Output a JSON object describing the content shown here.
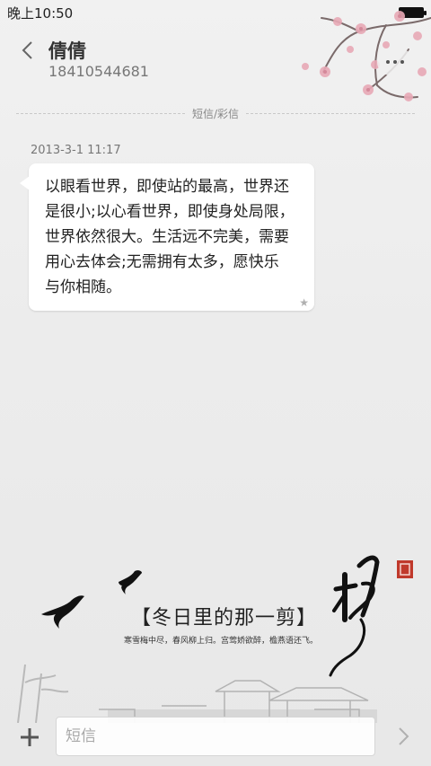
{
  "status_bar": {
    "time": "晚上10:50"
  },
  "header": {
    "contact_name": "倩倩",
    "contact_number": "18410544681"
  },
  "divider": {
    "label": "短信/彩信"
  },
  "messages": [
    {
      "timestamp": "2013-3-1 11:17",
      "lines": [
        "以眼看世界，即使站的最高，世界还",
        "是很小;以心看世界，即使身处局限，",
        "世界依然很大。生活远不完美，需要",
        "用心去体会;无需拥有太多，愿快乐",
        "与你相随。"
      ]
    }
  ],
  "theme_art": {
    "title": "【冬日里的那一剪】",
    "poem": "寒雪梅中尽，春风柳上归。宫莺娇欲醉，檐燕语还飞。"
  },
  "composer": {
    "placeholder": "短信"
  },
  "colors": {
    "background": "#ececec",
    "bubble": "#ffffff",
    "blossom": "#e8a9b6"
  },
  "icons": {
    "back": "chevron-left-icon",
    "more": "more-dots-icon",
    "star": "star-icon",
    "plus": "plus-icon",
    "send": "chevron-right-icon",
    "battery": "battery-icon"
  }
}
